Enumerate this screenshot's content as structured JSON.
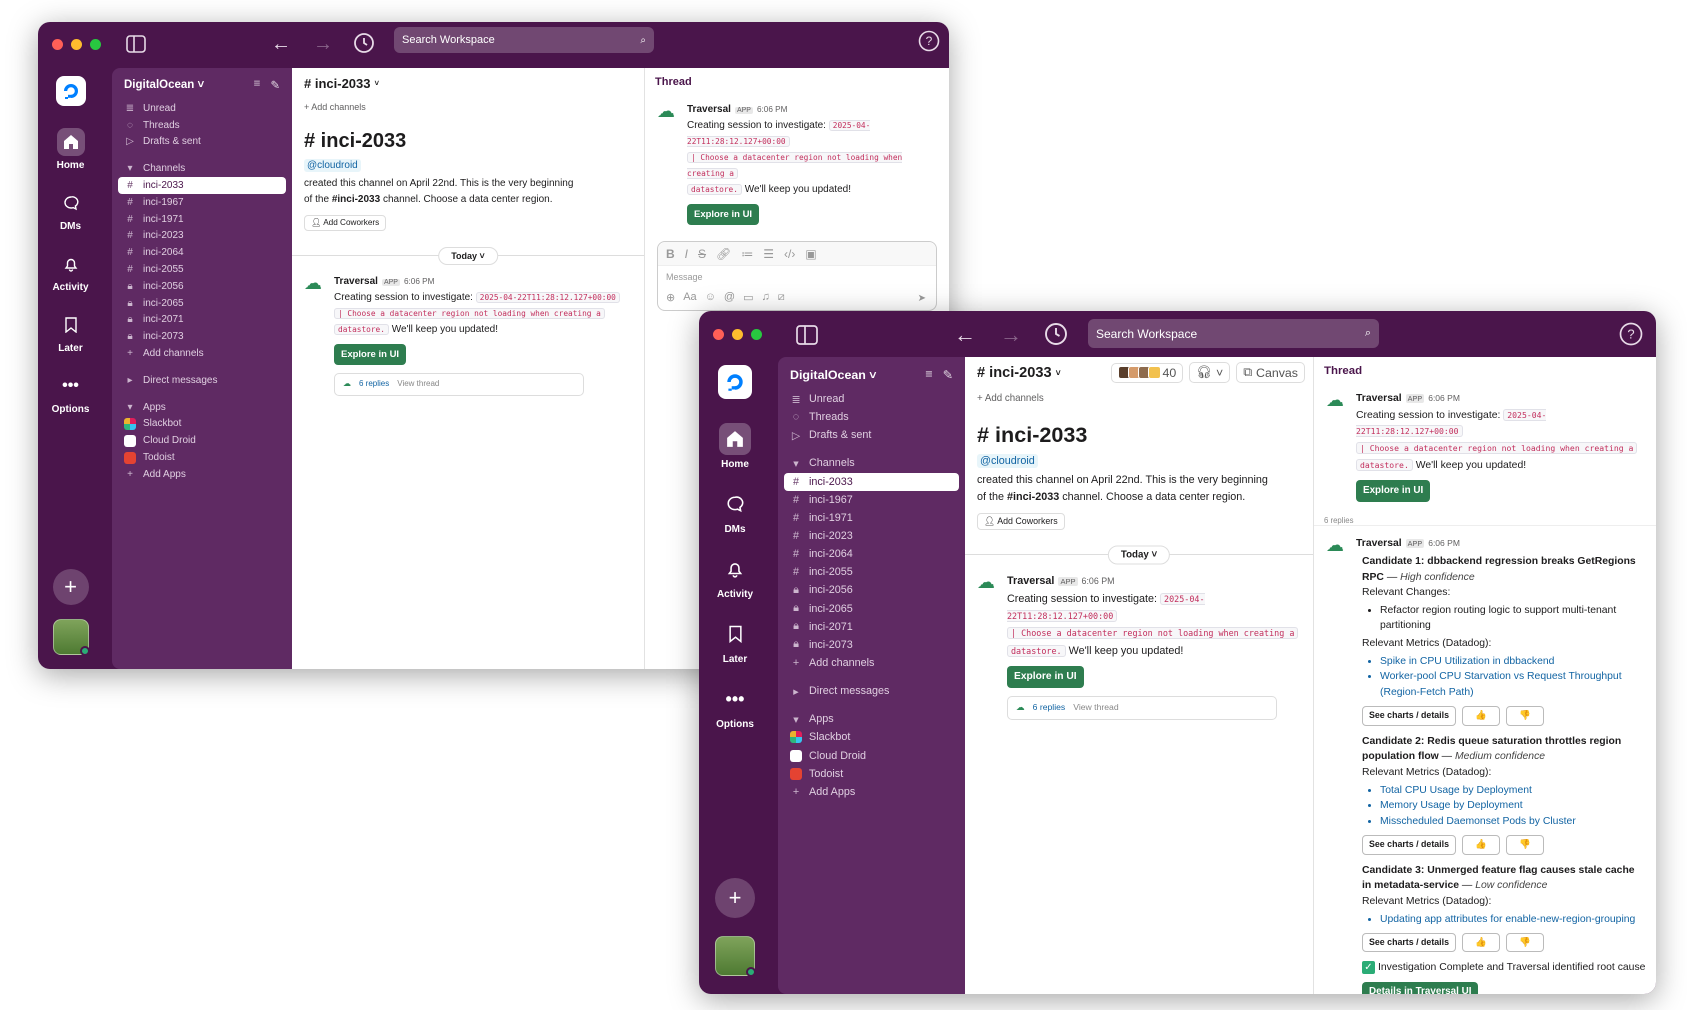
{
  "search": {
    "placeholder": "Search Workspace"
  },
  "rail": {
    "home": "Home",
    "dms": "DMs",
    "activity": "Activity",
    "later": "Later",
    "options": "Options"
  },
  "workspace": {
    "name": "DigitalOcean"
  },
  "sidebar": {
    "top": [
      "Unread",
      "Threads",
      "Drafts & sent"
    ],
    "channels_label": "Channels",
    "channels": [
      "inci-2033",
      "inci-1967",
      "inci-1971",
      "inci-2023",
      "inci-2064",
      "inci-2055",
      "inci-2056",
      "inci-2065",
      "inci-2071",
      "inci-2073"
    ],
    "add_channels": "Add channels",
    "direct_messages": "Direct messages",
    "apps_label": "Apps",
    "apps": [
      "Slackbot",
      "Cloud Droid",
      "Todoist"
    ],
    "add_apps": "Add Apps"
  },
  "channel": {
    "name": "# inci-2033",
    "member_count": "40",
    "canvas": "Canvas",
    "add_channels": "+ Add channels",
    "intro_title": "# inci-2033",
    "mention": "@cloudroid",
    "intro_text_1": "created this channel on April 22nd. This is the very beginning",
    "intro_text_2a": "of the ",
    "intro_text_2b": "#inci-2033",
    "intro_text_2c": " channel. Choose a data center region.",
    "add_coworkers": "Add Coworkers",
    "today": "Today"
  },
  "message": {
    "author": "Traversal",
    "app_badge": "APP",
    "time": "6:06 PM",
    "text_1": "Creating session to investigate:",
    "code_1": "2025-04-22T11:28:12.127+00:00",
    "code_2": "| Choose a datacenter region not loading when creating a",
    "code_3": "datastore.",
    "text_2": "We'll keep you updated!",
    "button": "Explore in UI",
    "replies": "6 replies",
    "view_thread": "View thread"
  },
  "thread": {
    "title": "Thread",
    "composer_placeholder": "Message",
    "replies_label": "6 replies",
    "candidates": [
      {
        "title": "Candidate 1: dbbackend regression breaks GetRegions RPC",
        "sep": " — ",
        "confidence": "High confidence",
        "changes_label": "Relevant Changes:",
        "changes": [
          "Refactor region routing logic to support multi-tenant partitioning"
        ],
        "metrics_label": "Relevant Metrics (Datadog):",
        "metrics": [
          "Spike in CPU Utilization in dbbackend",
          "Worker-pool CPU Starvation vs Request Throughput (Region-Fetch Path)"
        ]
      },
      {
        "title": "Candidate 2: Redis queue saturation throttles region population flow",
        "sep": " — ",
        "confidence": "Medium confidence",
        "metrics_label": "Relevant Metrics (Datadog):",
        "metrics": [
          "Total CPU Usage by Deployment",
          "Memory Usage by Deployment",
          "Misscheduled Daemonset Pods by Cluster"
        ]
      },
      {
        "title": "Candidate 3: Unmerged feature flag causes stale cache in metadata-service",
        "sep": " — ",
        "confidence": "Low confidence",
        "metrics_label": "Relevant Metrics (Datadog):",
        "metrics": [
          "Updating app attributes for enable-new-region-grouping"
        ]
      }
    ],
    "see_charts": "See charts / details",
    "thumbs_up": "👍",
    "thumbs_down": "👎",
    "complete": "Investigation Complete and Traversal identified root cause",
    "details_button": "Details in Traversal UI"
  },
  "colors": {
    "aubergine": "#4a154b",
    "sidebar": "#5f2a63",
    "green": "#2e7d4f",
    "link": "#1264a3"
  }
}
